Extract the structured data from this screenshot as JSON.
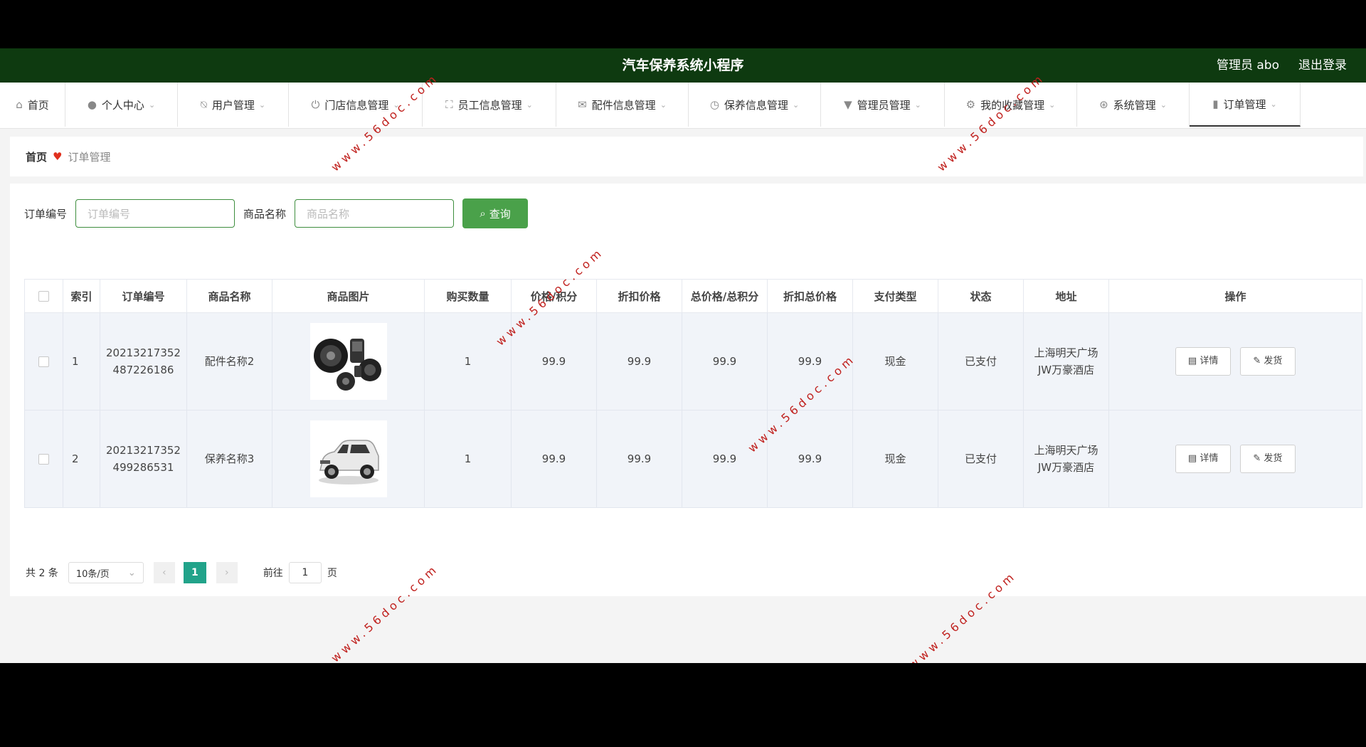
{
  "header": {
    "title": "汽车保养系统小程序",
    "user": "管理员 abo",
    "logout": "退出登录"
  },
  "nav": [
    {
      "label": "首页",
      "icon": "home-icon"
    },
    {
      "label": "个人中心",
      "icon": "user-icon"
    },
    {
      "label": "用户管理",
      "icon": "bell-off-icon"
    },
    {
      "label": "门店信息管理",
      "icon": "power-icon"
    },
    {
      "label": "员工信息管理",
      "icon": "fullscreen-icon"
    },
    {
      "label": "配件信息管理",
      "icon": "mail-icon"
    },
    {
      "label": "保养信息管理",
      "icon": "clock-icon"
    },
    {
      "label": "管理员管理",
      "icon": "brush-icon"
    },
    {
      "label": "我的收藏管理",
      "icon": "settings-icon"
    },
    {
      "label": "系统管理",
      "icon": "help-icon"
    },
    {
      "label": "订单管理",
      "icon": "chart-icon"
    }
  ],
  "breadcrumb": {
    "home": "首页",
    "current": "订单管理"
  },
  "search": {
    "order_label": "订单编号",
    "order_placeholder": "订单编号",
    "product_label": "商品名称",
    "product_placeholder": "商品名称",
    "button": "查询"
  },
  "table": {
    "headers": [
      "索引",
      "订单编号",
      "商品名称",
      "商品图片",
      "购买数量",
      "价格/积分",
      "折扣价格",
      "总价格/总积分",
      "折扣总价格",
      "支付类型",
      "状态",
      "地址",
      "操作"
    ],
    "rows": [
      {
        "index": "1",
        "order_no": "20213217352487226186",
        "product": "配件名称2",
        "image": "speaker-parts",
        "qty": "1",
        "price": "99.9",
        "discount_price": "99.9",
        "total": "99.9",
        "discount_total": "99.9",
        "pay_type": "现金",
        "status": "已支付",
        "address": "上海明天广场JW万豪酒店",
        "detail": "详情",
        "ship": "发货"
      },
      {
        "index": "2",
        "order_no": "20213217352499286531",
        "product": "保养名称3",
        "image": "white-suv",
        "qty": "1",
        "price": "99.9",
        "discount_price": "99.9",
        "total": "99.9",
        "discount_total": "99.9",
        "pay_type": "现金",
        "status": "已支付",
        "address": "上海明天广场JW万豪酒店",
        "detail": "详情",
        "ship": "发货"
      }
    ]
  },
  "pagination": {
    "total": "共 2 条",
    "page_size": "10条/页",
    "current": "1",
    "goto_label": "前往",
    "goto_value": "1",
    "page_suffix": "页"
  },
  "watermark": "www.56doc.com"
}
